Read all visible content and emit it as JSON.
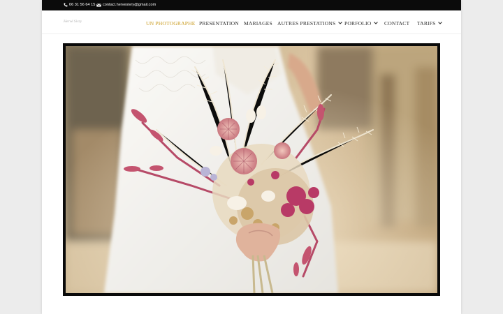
{
  "topbar": {
    "phone": "06 31 56 64 15",
    "email": "contact.hervesivry@gmail.com",
    "phone_icon": "phone-icon",
    "email_icon": "envelope-icon"
  },
  "logo": {
    "text": "Hervé Sivry"
  },
  "nav": {
    "items": [
      {
        "label": "UN PHOTOGRAPHE",
        "active": true
      },
      {
        "label": "PRESENTATION"
      },
      {
        "label": "MARIAGES"
      },
      {
        "label": "AUTRES PRESTATIONS",
        "dropdown": true
      },
      {
        "label": "PORFOLIO",
        "dropdown": true
      },
      {
        "label": "CONTACT"
      },
      {
        "label": "TARIFS",
        "dropdown": true
      }
    ]
  },
  "hero": {
    "description": "Mariée tenant un bouquet de fleurs séchées roses et crème"
  },
  "colors": {
    "accent": "#c99a1c",
    "topbar_bg": "#0b0b0b",
    "nav_text": "#2a2a2a"
  }
}
